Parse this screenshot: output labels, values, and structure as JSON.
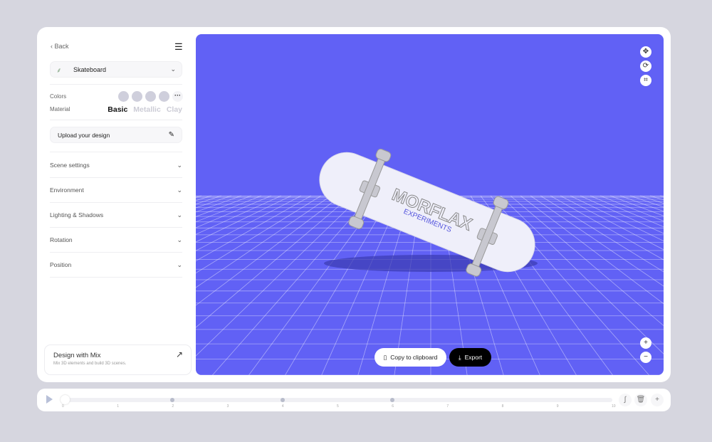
{
  "sidebar": {
    "back": "Back",
    "product": "Skateboard",
    "colors_label": "Colors",
    "material_label": "Material",
    "materials": [
      "Basic",
      "Metallic",
      "Clay"
    ],
    "selected_material": "Basic",
    "swatch_colors": [
      "#cfcfdc",
      "#cfcfdc",
      "#cfcfdc",
      "#cfcfdc"
    ],
    "upload": "Upload your design",
    "sections": [
      "Scene settings",
      "Environment",
      "Lighting & Shadows",
      "Rotation",
      "Position"
    ],
    "mix": {
      "title": "Design with Mix",
      "subtitle": "Mix 3D elements and build 3D scenes."
    }
  },
  "viewport": {
    "background": "#6161f5",
    "tools": [
      "move-icon",
      "rotate-icon",
      "crop-icon"
    ],
    "board_text": "MORFLAX",
    "board_subtext": "EXPERIMENTS",
    "copy": "Copy to clipboard",
    "export": "Export"
  },
  "timeline": {
    "ticks": [
      "0",
      "1",
      "2",
      "3",
      "4",
      "5",
      "6",
      "7",
      "8",
      "9",
      "10"
    ],
    "keyframes": [
      2,
      4,
      6
    ],
    "position": 0
  }
}
